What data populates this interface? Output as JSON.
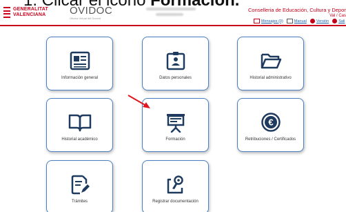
{
  "instruction": {
    "step": "1. Clicar el icono",
    "keyword": "Formación."
  },
  "header": {
    "gva_line1": "GENERALITAT",
    "gva_line2": "VALENCIANA",
    "ovidoc_name": "OVIDOC",
    "ovidoc_tagline": "Oficina Virtual del Docent",
    "conselleria": "Conselleria de Educación, Cultura y Deporte",
    "lang": "Val / Cas",
    "links": [
      {
        "label": "Mensajes (0)",
        "icon": "mail-icon"
      },
      {
        "label": "Manual",
        "icon": "book-icon"
      },
      {
        "label": "Versión",
        "icon": "info-icon"
      },
      {
        "label": "Sali",
        "icon": "exit-icon"
      }
    ],
    "accent": "#c8001c"
  },
  "tiles": [
    {
      "label": "Información general",
      "icon": "newspaper-icon"
    },
    {
      "label": "Datos personales",
      "icon": "id-card-icon"
    },
    {
      "label": "Historial administrativo",
      "icon": "folder-icon"
    },
    {
      "label": "Historial académico",
      "icon": "open-book-icon"
    },
    {
      "label": "Formación",
      "icon": "presentation-board-icon"
    },
    {
      "label": "Retribuciones / Certificados",
      "icon": "euro-icon"
    },
    {
      "label": "Trámites",
      "icon": "document-edit-icon"
    },
    {
      "label": "Registrar documentación",
      "icon": "register-document-icon"
    }
  ],
  "colors": {
    "tile_border": "#4a80bf",
    "icon_navy": "#1e3a5f",
    "arrow": "#e0161e"
  }
}
